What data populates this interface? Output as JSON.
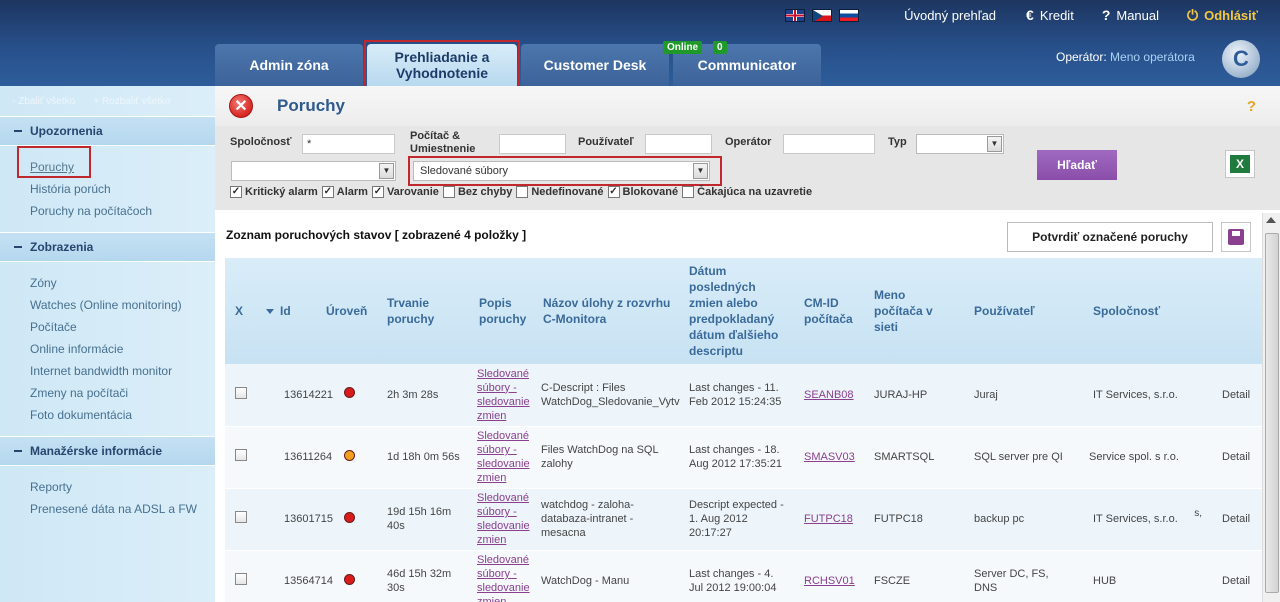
{
  "header": {
    "flags": [
      "en-flag",
      "cz-flag",
      "sk-flag"
    ],
    "links": {
      "home": "Úvodný prehľad",
      "credit": "Kredit",
      "manual": "Manual",
      "logout": "Odhlásiť"
    },
    "tabs": [
      {
        "label": "Admin zóna"
      },
      {
        "label": "Prehliadanie a Vyhodnotenie"
      },
      {
        "label": "Customer Desk"
      },
      {
        "label": "Communicator",
        "badge_online": "Online",
        "badge_count": "0"
      }
    ],
    "operator_label": "Operátor:",
    "operator_name": "Meno operátora",
    "logo_letter": "C"
  },
  "sidebar": {
    "collapse_all": "- Zbaliť všetko",
    "expand_all": "+ Rozbaliť všetko",
    "sections": [
      {
        "title": "Upozornenia",
        "items": [
          "Poruchy",
          "História porúch",
          "Poruchy na počítačoch"
        ]
      },
      {
        "title": "Zobrazenia",
        "items": [
          "Zóny",
          "Watches (Online monitoring)",
          "Počítače",
          "Online informácie",
          "Internet bandwidth monitor",
          "Zmeny na počítači",
          "Foto dokumentácia"
        ]
      },
      {
        "title": "Manažérske informácie",
        "items": [
          "Reporty",
          "Prenesené dáta na ADSL a FW"
        ]
      }
    ]
  },
  "page": {
    "title": "Poruchy",
    "help": "?"
  },
  "filters": {
    "company_label": "Spoločnosť",
    "company_value": "*",
    "pc_label": "Počítač & Umiestnenie",
    "user_label": "Používateľ",
    "operator_label": "Operátor",
    "type_label": "Typ",
    "watch_select": "Sledované súbory",
    "search_button": "Hľadať",
    "checkboxes": [
      {
        "label": "Kritický alarm",
        "checked": "✓"
      },
      {
        "label": "Alarm",
        "checked": "✓"
      },
      {
        "label": "Varovanie",
        "checked": "✓"
      },
      {
        "label": "Bez chyby",
        "checked": ""
      },
      {
        "label": "Nedefinované",
        "checked": ""
      },
      {
        "label": "Blokované",
        "checked": "✓"
      },
      {
        "label": "Čakajúca na uzavretie",
        "checked": ""
      }
    ]
  },
  "list": {
    "heading": "Zoznam poruchových stavov",
    "shown_prefix": "[ zobrazené ",
    "shown_count": "4",
    "shown_suffix": " položky ]",
    "confirm_button": "Potvrdiť označené poruchy"
  },
  "table": {
    "headers": [
      "X",
      "Id",
      "Úroveň",
      "Trvanie poruchy",
      "Popis poruchy",
      "Názov úlohy z rozvrhu C-Monitora",
      "Dátum posledných zmien alebo predpokladaný dátum ďalšieho descriptu",
      "CM-ID počítača",
      "Meno počítača v sieti",
      "Používateľ",
      "Spoločnosť",
      ""
    ],
    "rows": [
      {
        "id": "13614221",
        "level_color": "#d81b1b",
        "duration": "2h 3m 28s",
        "desc": "Sledované súbory - sledovanie zmien",
        "task": "C-Descript : Files WatchDog_Sledovanie_Vytv",
        "date": "Last changes - 11. Feb 2012 15:24:35",
        "cmid": "SEANB08",
        "pcname": "JURAJ-HP",
        "user": "Juraj",
        "company": "IT Services, s.r.o.",
        "detail": "Detail"
      },
      {
        "id": "13611264",
        "level_color": "#f0a020",
        "duration": "1d 18h 0m 56s",
        "desc": "Sledované súbory - sledovanie zmien",
        "task": "Files WatchDog na SQL zalohy",
        "date": "Last changes - 18. Aug 2012 17:35:21",
        "cmid": "SMASV03",
        "pcname": "SMARTSQL",
        "user": "SQL server pre QI",
        "company": "Service spol. s r.o.",
        "detail": "Detail"
      },
      {
        "id": "13601715",
        "level_color": "#d81b1b",
        "duration": "19d 15h 16m 40s",
        "desc": "Sledované súbory - sledovanie zmien",
        "task": "watchdog - zaloha-databaza-intranet - mesacna",
        "date": "Descript expected - 1. Aug 2012 20:17:27",
        "cmid": "FUTPC18",
        "pcname": "FUTPC18",
        "user": "backup pc",
        "company": "IT Services, s.r.o.",
        "company_sup": "s,",
        "detail": "Detail"
      },
      {
        "id": "13564714",
        "level_color": "#d81b1b",
        "duration": "46d 15h 32m 30s",
        "desc": "Sledované súbory - sledovanie zmien",
        "task": "WatchDog - Manu",
        "date": "Last changes - 4. Jul 2012 19:00:04",
        "cmid": "RCHSV01",
        "pcname": "FSCZE",
        "user": "Server DC, FS, DNS",
        "company": "HUB",
        "detail": "Detail"
      }
    ]
  }
}
